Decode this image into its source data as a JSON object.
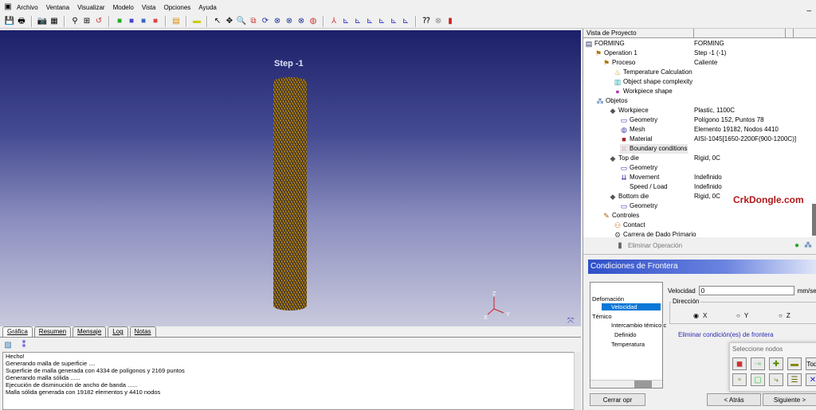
{
  "menu": [
    "Archivo",
    "Ventana",
    "Visualizar",
    "Modelo",
    "Vista",
    "Opciones",
    "Ayuda"
  ],
  "viewport": {
    "step_label": "Step  -1",
    "axis": {
      "z": "Z",
      "x": "X",
      "y": "Y"
    }
  },
  "tabs": [
    "Gráfica",
    "Resumen",
    "Mensaje",
    "Log",
    "Notas"
  ],
  "log": [
    "Hecho!",
    "",
    "",
    "Generando malla de superficie ....",
    "Superficie de malla generada con 4334 de polígonos y 2169 puntos",
    "Generando malla sólida ......",
    "Ejecución de disminución de ancho de banda ......",
    "Malla sólida generada con 19182 elementos y 4410 nodos"
  ],
  "tree": {
    "header": "Vista de Proyecto",
    "rows": [
      {
        "label": "FORMING",
        "value": "FORMING",
        "icon": "project-icon"
      },
      {
        "label": "Operation 1",
        "value": "Step -1 (-1)",
        "icon": "operation-icon"
      },
      {
        "label": "Proceso",
        "value": "Caliente",
        "icon": "process-icon"
      },
      {
        "label": "Temperature Calculation",
        "value": "",
        "icon": "temperature-icon"
      },
      {
        "label": "Object shape complexity",
        "value": "",
        "icon": "complexity-icon"
      },
      {
        "label": "Workpiece shape",
        "value": "",
        "icon": "shape-icon"
      },
      {
        "label": "Objetos",
        "value": "",
        "icon": "objects-icon"
      },
      {
        "label": "Workpiece",
        "value": "Plastic, 1100C",
        "icon": "object-icon"
      },
      {
        "label": "Geometry",
        "value": "Polígono 152, Puntos 78",
        "icon": "geometry-icon"
      },
      {
        "label": "Mesh",
        "value": "Elemento 19182, Nodos 4410",
        "icon": "mesh-icon"
      },
      {
        "label": "Material",
        "value": "AISI-1045[1650-2200F(900-1200C)]",
        "icon": "material-icon"
      },
      {
        "label": "Boundary conditions",
        "value": "",
        "icon": "boundary-icon"
      },
      {
        "label": "Top die",
        "value": "Rigid, 0C",
        "icon": "object-icon"
      },
      {
        "label": "Geometry",
        "value": "",
        "icon": "geometry-icon"
      },
      {
        "label": "Movement",
        "value": "Indefinido",
        "icon": "movement-icon"
      },
      {
        "label": "Speed / Load",
        "value": "Indefinido",
        "icon": ""
      },
      {
        "label": "Bottom die",
        "value": "Rigid, 0C",
        "icon": "object-icon"
      },
      {
        "label": "Geometry",
        "value": "",
        "icon": "geometry-icon"
      },
      {
        "label": "Controles",
        "value": "",
        "icon": "controls-icon"
      },
      {
        "label": "Contact",
        "value": "",
        "icon": "contact-icon"
      },
      {
        "label": "Carrera de Dado Primario",
        "value": "",
        "icon": "stroke-icon"
      }
    ]
  },
  "watermark": "CrkDongle.com",
  "op_bar": {
    "delete_label": "Eliminar Operación"
  },
  "bc": {
    "title": "Condiciones de Frontera",
    "list": [
      "Defomación",
      "Velocidad",
      "Témico",
      "Intercambio témico c",
      "Definido",
      "Temperatura"
    ],
    "vel_label": "Velocidad",
    "vel_value": "0",
    "vel_unit": "mm/sec",
    "dir_label": "Dirección",
    "dirs": [
      "X",
      "Y",
      "Z"
    ],
    "selected_dir": "X",
    "delete_link": "Eliminar condición(es) de frontera",
    "select_nodes": "Seleccione nodos",
    "all_label": "Todo",
    "close": "Cerrar opr",
    "back": "< Atrás",
    "next": "Siguiente >"
  },
  "colors": {
    "accent": "#2f4fc8",
    "selection": "#0a78d7",
    "mesh": "#d6b630"
  }
}
